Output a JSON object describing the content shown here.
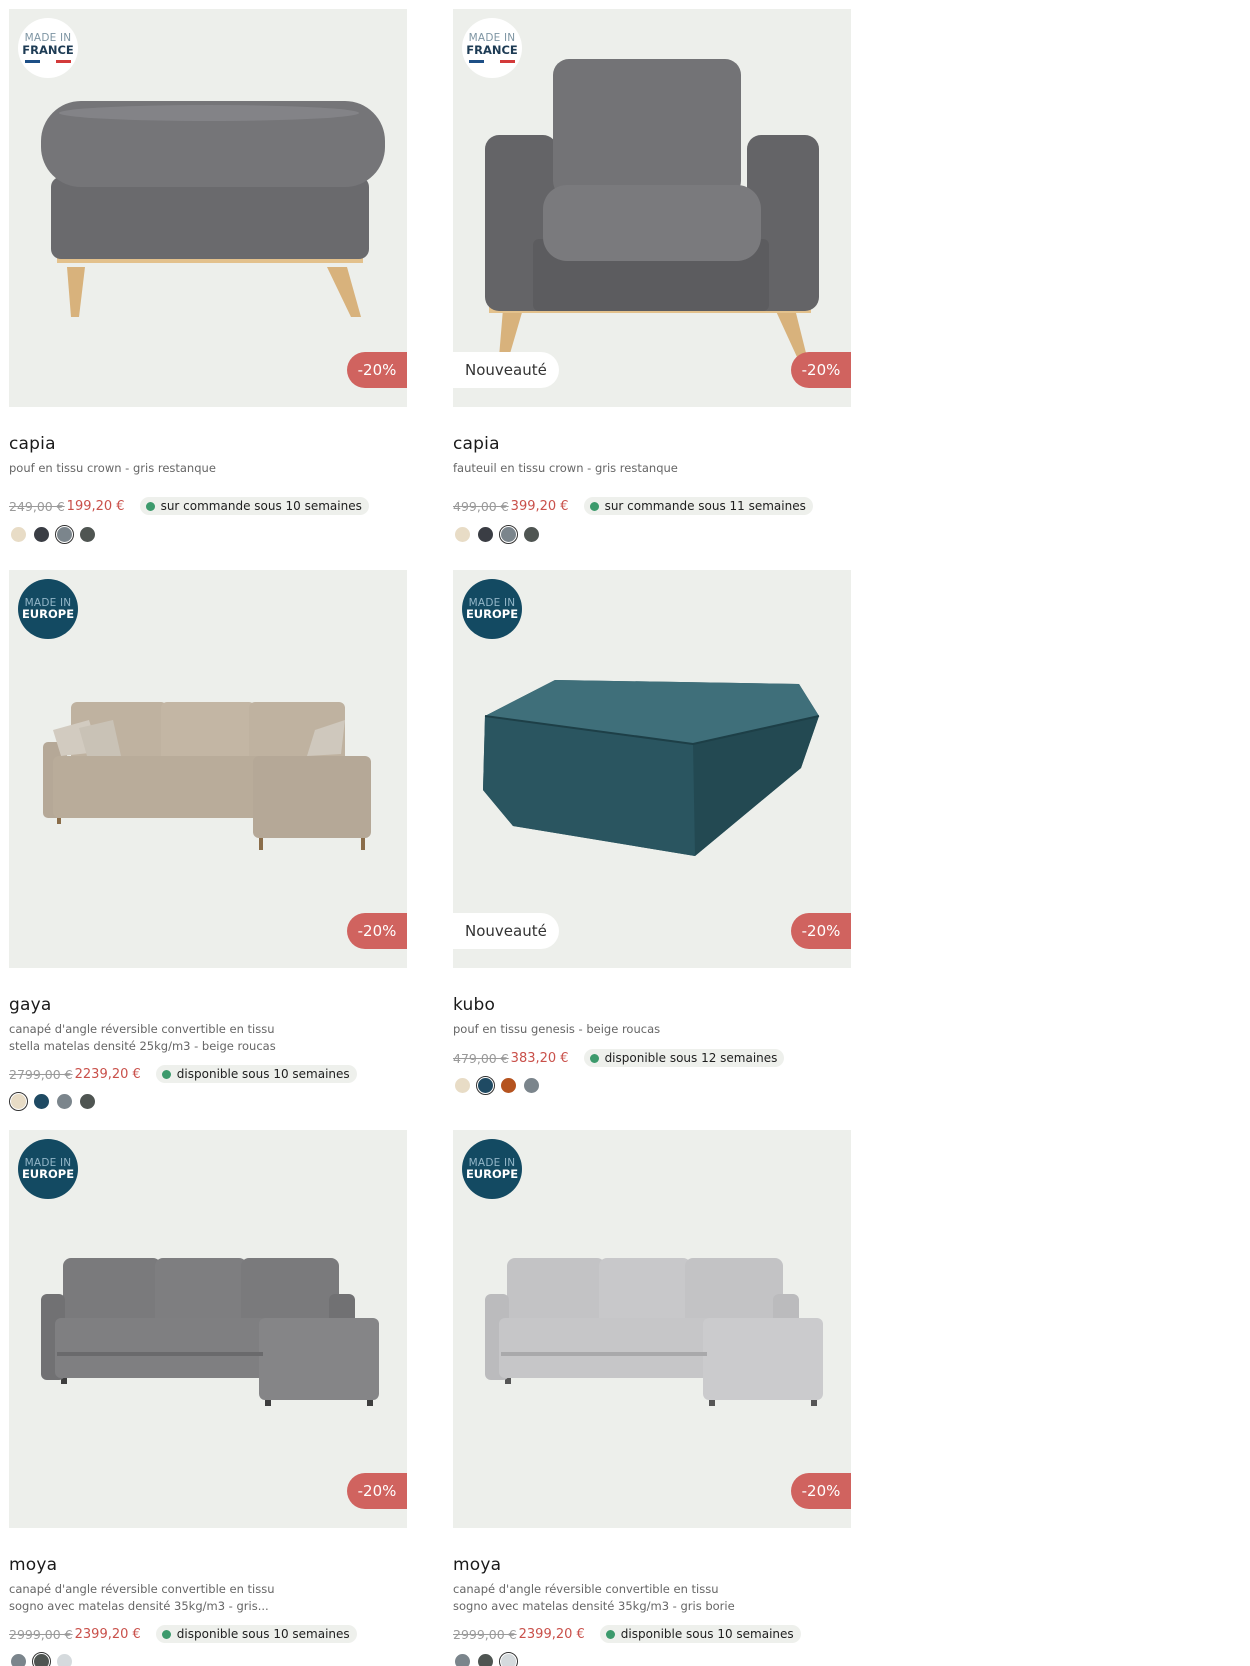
{
  "products": [
    {
      "origin_line1": "MADE IN",
      "origin_line2": "FRANCE",
      "origin_style": "france",
      "new_label": "",
      "discount": "-20%",
      "name": "capia",
      "description": "pouf en tissu crown - gris restanque",
      "old_price": "249,00 €",
      "new_price": "199,20 €",
      "availability": "sur commande sous 10 semaines",
      "image_icon": "pouf-icon",
      "swatches": [
        "#e8dcc6",
        "#3a3d44",
        "#7b858c",
        "#4f5552"
      ],
      "selected_swatch": 2
    },
    {
      "origin_line1": "MADE IN",
      "origin_line2": "FRANCE",
      "origin_style": "france",
      "new_label": "Nouveauté",
      "discount": "-20%",
      "name": "capia",
      "description": "fauteuil en tissu crown - gris restanque",
      "old_price": "499,00 €",
      "new_price": "399,20 €",
      "availability": "sur commande sous 11 semaines",
      "image_icon": "armchair-icon",
      "swatches": [
        "#e8dcc6",
        "#3a3d44",
        "#7b858c",
        "#4f5552"
      ],
      "selected_swatch": 2
    },
    {
      "origin_line1": "MADE IN",
      "origin_line2": "EUROPE",
      "origin_style": "europe",
      "new_label": "",
      "discount": "-20%",
      "name": "gaya",
      "description": "canapé d'angle réversible convertible en tissu stella matelas densité 25kg/m3 - beige roucas",
      "old_price": "2799,00 €",
      "new_price": "2239,20 €",
      "availability": "disponible sous 10 semaines",
      "image_icon": "corner-sofa-icon",
      "swatches": [
        "#e8dcc6",
        "#1f4a63",
        "#7b858c",
        "#4f5552"
      ],
      "selected_swatch": 0
    },
    {
      "origin_line1": "MADE IN",
      "origin_line2": "EUROPE",
      "origin_style": "europe",
      "new_label": "Nouveauté",
      "discount": "-20%",
      "name": "kubo",
      "description": "pouf en tissu genesis - beige roucas",
      "old_price": "479,00 €",
      "new_price": "383,20 €",
      "availability": "disponible sous 12 semaines",
      "image_icon": "square-pouf-icon",
      "swatches": [
        "#e8dcc6",
        "#1f4a63",
        "#b5531f",
        "#7b858c"
      ],
      "selected_swatch": 1
    },
    {
      "origin_line1": "MADE IN",
      "origin_line2": "EUROPE",
      "origin_style": "europe",
      "new_label": "",
      "discount": "-20%",
      "name": "moya",
      "description": "canapé d'angle réversible convertible en tissu sogno avec matelas densité 35kg/m3 - gris...",
      "old_price": "2999,00 €",
      "new_price": "2399,20 €",
      "availability": "disponible sous 10 semaines",
      "image_icon": "corner-sofa-icon",
      "swatches": [
        "#7b858c",
        "#4f5552",
        "#d5dadd"
      ],
      "selected_swatch": 1
    },
    {
      "origin_line1": "MADE IN",
      "origin_line2": "EUROPE",
      "origin_style": "europe",
      "new_label": "",
      "discount": "-20%",
      "name": "moya",
      "description": "canapé d'angle réversible convertible en tissu sogno avec matelas densité 35kg/m3 - gris borie",
      "old_price": "2999,00 €",
      "new_price": "2399,20 €",
      "availability": "disponible sous 10 semaines",
      "image_icon": "corner-sofa-icon",
      "swatches": [
        "#7b858c",
        "#4f5552",
        "#d5dadd"
      ],
      "selected_swatch": 2
    }
  ],
  "colors": {
    "discount_badge": "#d0635f",
    "new_price": "#c9504a",
    "availability_dot": "#3c9a6c",
    "europe_badge": "#134a62",
    "image_background": "#edefeb"
  }
}
